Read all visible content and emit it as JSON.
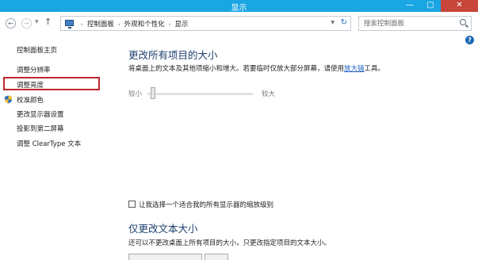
{
  "window": {
    "title": "显示",
    "minimize_glyph": "—",
    "maximize_glyph": "□",
    "close_glyph": "✕"
  },
  "nav": {
    "back_glyph": "←",
    "forward_glyph": "→",
    "dropdown_glyph": "▼",
    "up_glyph": "↑"
  },
  "address": {
    "breadcrumb": [
      "控制面板",
      "外观和个性化",
      "显示"
    ],
    "separator": "›",
    "dropdown_glyph": "▼",
    "refresh_glyph": "↻"
  },
  "search": {
    "placeholder": "搜索控制面板"
  },
  "help_glyph": "?",
  "sidebar": {
    "home": "控制面板主页",
    "items": [
      {
        "label": "调整分辨率"
      },
      {
        "label": "调整亮度"
      },
      {
        "label": "校准颜色"
      },
      {
        "label": "更改显示器设置"
      },
      {
        "label": "投影到第二屏幕"
      },
      {
        "label": "调整 ClearType 文本"
      }
    ]
  },
  "main": {
    "heading": "更改所有项目的大小",
    "description_prefix": "将桌面上的文本及其他项缩小和增大。若要临时仅放大部分屏幕，请使用",
    "description_link": "放大镜",
    "description_suffix": "工具。",
    "slider": {
      "min_label": "较小",
      "max_label": "较大",
      "value_fraction": 0.0
    },
    "checkbox": {
      "label": "让我选择一个适合我的所有显示器的缩放级别",
      "checked": false
    },
    "text_only_heading": "仅更改文本大小",
    "text_only_description": "还可以不更改桌面上所有项目的大小，只更改指定项目的文本大小。"
  },
  "colors": {
    "titlebar": "#1aa5e3",
    "heading": "#1d3f6e",
    "link": "#1a5ec0",
    "highlight": "#c1272d"
  }
}
